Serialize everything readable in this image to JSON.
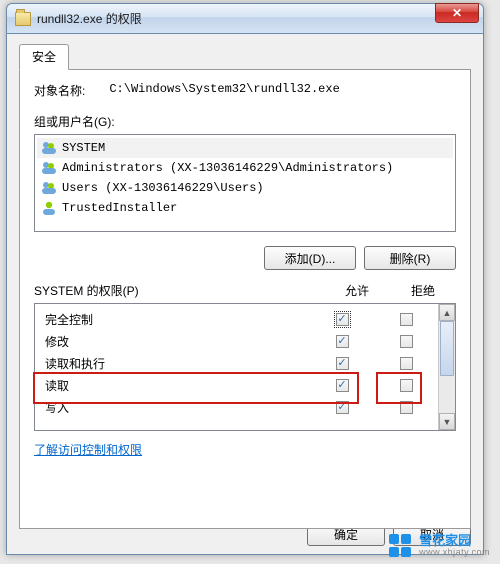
{
  "window": {
    "title": "rundll32.exe 的权限",
    "close_glyph": "✕"
  },
  "tab": {
    "security": "安全"
  },
  "object_row": {
    "label": "对象名称:",
    "value": "C:\\Windows\\System32\\rundll32.exe"
  },
  "group_label": "组或用户名(G):",
  "principals": [
    {
      "name": "SYSTEM"
    },
    {
      "name": "Administrators (XX-13036146229\\Administrators)"
    },
    {
      "name": "Users (XX-13036146229\\Users)"
    },
    {
      "name": "TrustedInstaller"
    }
  ],
  "buttons": {
    "add": "添加(D)...",
    "remove": "删除(R)"
  },
  "perm_header": {
    "title_prefix": "SYSTEM 的权限(P)",
    "allow": "允许",
    "deny": "拒绝"
  },
  "permissions": [
    {
      "name": "完全控制",
      "allow": true,
      "deny": false,
      "focus": true
    },
    {
      "name": "修改",
      "allow": true,
      "deny": false
    },
    {
      "name": "读取和执行",
      "allow": true,
      "deny": false
    },
    {
      "name": "读取",
      "allow": true,
      "deny": false
    },
    {
      "name": "写入",
      "allow": true,
      "deny": false
    }
  ],
  "link": "了解访问控制和权限",
  "dialog_buttons": {
    "ok": "确定",
    "cancel": "取消"
  },
  "watermark": {
    "brand": "雪花家园",
    "url": "www.xhjaty.com"
  },
  "scroll": {
    "up": "▲",
    "down": "▼"
  }
}
